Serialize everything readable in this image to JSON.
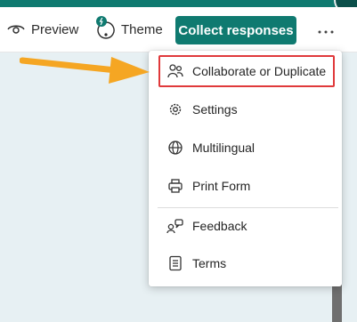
{
  "toolbar": {
    "preview_label": "Preview",
    "theme_label": "Theme",
    "collect_label": "Collect responses",
    "more_icon": "more-horizontal-icon"
  },
  "menu": {
    "items": [
      {
        "label": "Collaborate or Duplicate",
        "icon": "people-icon"
      },
      {
        "label": "Settings",
        "icon": "gear-icon"
      },
      {
        "label": "Multilingual",
        "icon": "globe-icon"
      },
      {
        "label": "Print Form",
        "icon": "printer-icon"
      },
      {
        "label": "Feedback",
        "icon": "feedback-icon"
      },
      {
        "label": "Terms",
        "icon": "document-icon"
      }
    ]
  },
  "annotation": {
    "highlight_color": "#e0393b",
    "arrow_color": "#f5a623"
  },
  "colors": {
    "accent": "#0f7a70",
    "canvas": "#e7f0f3"
  }
}
